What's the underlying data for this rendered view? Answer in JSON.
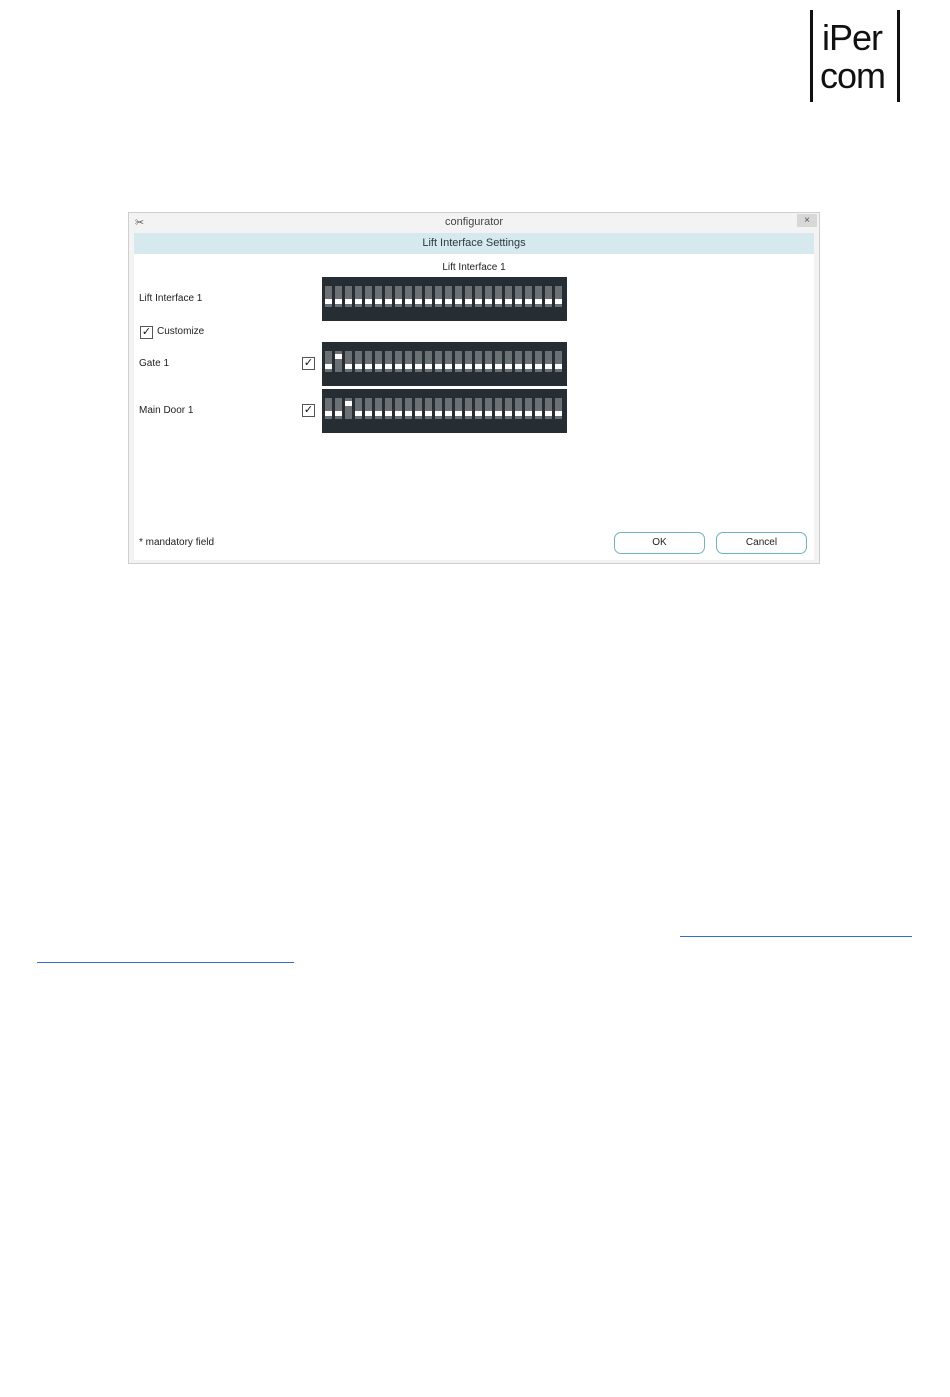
{
  "logo": {
    "line1": "iPer",
    "line2": "com"
  },
  "window": {
    "title": "configurator",
    "close_glyph": "×",
    "app_icon": "configurator-app-icon"
  },
  "dialog": {
    "header": "Lift Interface Settings",
    "subtitle": "Lift Interface 1",
    "rows": {
      "lift": {
        "label": "Lift Interface 1",
        "up_switches": []
      },
      "customize": {
        "label": "Customize",
        "checked": true
      },
      "gate": {
        "label": "Gate 1",
        "checked": true,
        "up_switches": [
          2
        ]
      },
      "main_door": {
        "label": "Main Door 1",
        "checked": true,
        "up_switches": [
          3
        ]
      }
    },
    "switch_count": 24,
    "mandatory_note": "* mandatory field",
    "ok_label": "OK",
    "cancel_label": "Cancel",
    "check_glyph": "✓"
  },
  "colors": {
    "header_band": "#d5e9ef",
    "dip_background": "#262d33",
    "switch_numbers": "#4fb3d9",
    "button_border": "#6fb6b8",
    "link": "#2f6fd0"
  }
}
